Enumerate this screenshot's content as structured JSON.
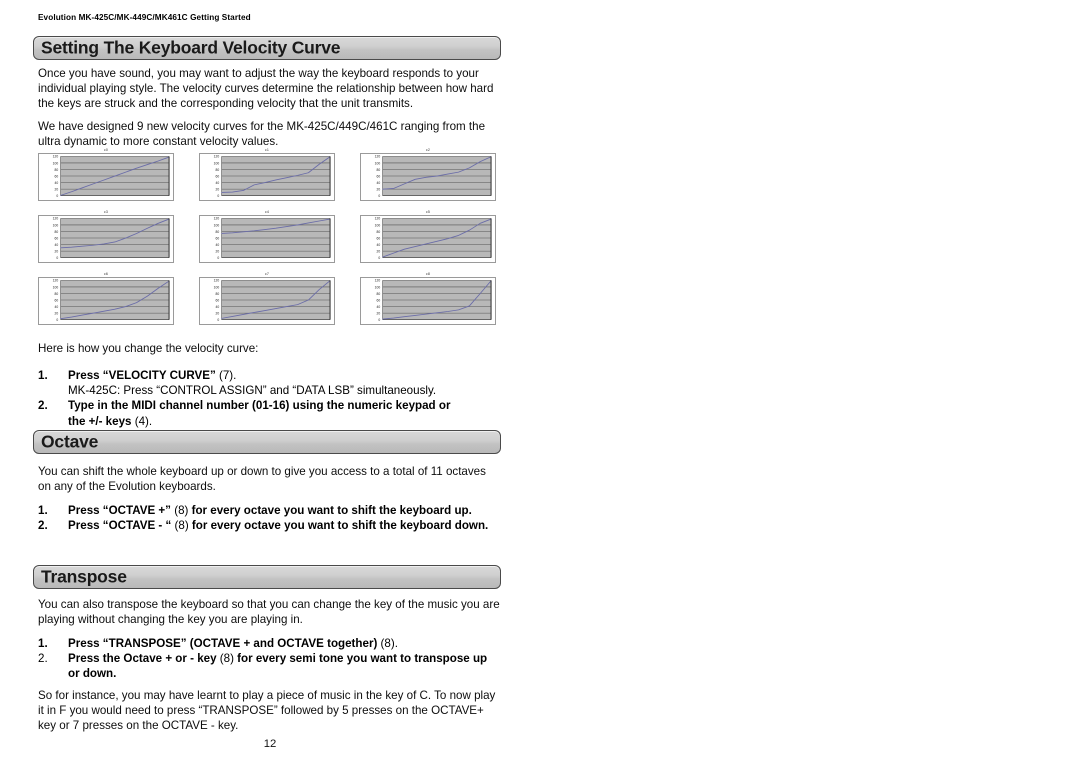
{
  "document": {
    "running_head": "Evolution MK-425C/MK-449C/MK461C Getting Started",
    "page_number": "12"
  },
  "sections": [
    {
      "id": "velocity-curve",
      "heading": "Setting The Keyboard Velocity Curve",
      "paragraphs": [
        [
          "Once you have sound, you may want to adjust the way the keyboard responds to your",
          "individual playing style. The velocity curves determine the relationship between how hard",
          "the keys are struck and the corresponding velocity that the unit transmits."
        ],
        [
          "We have designed 9 new velocity curves for the MK-425C/449C/461C ranging from the",
          "ultra dynamic to more constant velocity values."
        ]
      ],
      "lead_in": "Here is how you change the velocity curve:",
      "steps": [
        {
          "num": "1.",
          "bold": "Press “VELOCITY CURVE”",
          "regular": " (7).",
          "sub": "MK-425C: Press “CONTROL ASSIGN” and “DATA LSB” simultaneously."
        },
        {
          "num": "2.",
          "bold": "Type in the MIDI channel number (01-16) using the numeric keypad or",
          "regular": "",
          "line2_bold": "the +/- keys",
          "line2_regular": " (4)."
        }
      ]
    },
    {
      "id": "octave",
      "heading": "Octave",
      "paragraphs": [
        [
          "You can shift the whole keyboard up or down to give you access to a total of 11 octaves",
          "on any of the Evolution keyboards."
        ]
      ],
      "steps": [
        {
          "num": "1.",
          "bold": "Press “OCTAVE +”",
          "regular": " (8)",
          "bold2": " for every octave you want to shift the keyboard  up."
        },
        {
          "num": "2.",
          "bold": "Press “OCTAVE - “",
          "regular": " (8)",
          "bold2": " for every octave you want to shift the keyboard down."
        }
      ]
    },
    {
      "id": "transpose",
      "heading": "Transpose",
      "paragraphs": [
        [
          "You can also transpose the keyboard so that you can change the key of the music you are",
          "playing without changing the key you are playing in."
        ]
      ],
      "steps": [
        {
          "num": "1.",
          "bold": "Press “TRANSPOSE” (OCTAVE + and OCTAVE together)",
          "regular": " (8)."
        },
        {
          "num": "2.",
          "bold": "Press the Octave + or - key",
          "regular": " (8)",
          "bold2": " for every semi tone you want to transpose up",
          "line2_bold": "or down."
        }
      ],
      "closing": [
        "So for instance, you may have learnt to play a piece of music in the key of C. To now play",
        "it in F you would need to press “TRANSPOSE” followed by 5 presses on the OCTAVE+",
        "key or 7 presses on the OCTAVE - key."
      ]
    }
  ],
  "chart_data": [
    {
      "type": "line",
      "title": "c0",
      "xlabel": "",
      "ylabel": "",
      "ylim": [
        0,
        120
      ],
      "yticks": [
        0,
        20,
        40,
        60,
        80,
        100,
        120
      ],
      "ytick_labels": [
        "0",
        "20",
        "40",
        "60",
        "80",
        "100",
        "120"
      ],
      "grid": true,
      "plot_bg": "#b8b8b8",
      "line_color": "#6a6ca8",
      "x": [
        0,
        10,
        20,
        30,
        40,
        50,
        60,
        70,
        80,
        90,
        100
      ],
      "values": [
        1,
        12,
        24,
        36,
        48,
        60,
        72,
        84,
        95,
        106,
        118
      ]
    },
    {
      "type": "line",
      "title": "c1",
      "xlabel": "",
      "ylabel": "",
      "ylim": [
        0,
        120
      ],
      "yticks": [
        0,
        20,
        40,
        60,
        80,
        100,
        120
      ],
      "ytick_labels": [
        "0",
        "20",
        "40",
        "60",
        "80",
        "100",
        "120"
      ],
      "grid": true,
      "plot_bg": "#b8b8b8",
      "line_color": "#6a6ca8",
      "x": [
        0,
        10,
        20,
        30,
        40,
        50,
        60,
        70,
        80,
        90,
        100
      ],
      "values": [
        10,
        11,
        16,
        33,
        40,
        48,
        55,
        62,
        70,
        96,
        119
      ]
    },
    {
      "type": "line",
      "title": "c2",
      "xlabel": "",
      "ylabel": "",
      "ylim": [
        0,
        120
      ],
      "yticks": [
        0,
        20,
        40,
        60,
        80,
        100,
        120
      ],
      "ytick_labels": [
        "0",
        "20",
        "40",
        "60",
        "80",
        "100",
        "120"
      ],
      "grid": true,
      "plot_bg": "#b8b8b8",
      "line_color": "#6a6ca8",
      "x": [
        0,
        10,
        20,
        30,
        40,
        50,
        60,
        70,
        80,
        90,
        100
      ],
      "values": [
        20,
        22,
        36,
        50,
        56,
        60,
        66,
        72,
        85,
        104,
        119
      ]
    },
    {
      "type": "line",
      "title": "c3",
      "xlabel": "",
      "ylabel": "",
      "ylim": [
        0,
        120
      ],
      "yticks": [
        0,
        20,
        40,
        60,
        80,
        100,
        120
      ],
      "ytick_labels": [
        "0",
        "20",
        "40",
        "60",
        "80",
        "100",
        "120"
      ],
      "grid": true,
      "plot_bg": "#b8b8b8",
      "line_color": "#6a6ca8",
      "x": [
        0,
        10,
        20,
        30,
        40,
        50,
        60,
        70,
        80,
        90,
        100
      ],
      "values": [
        30,
        32,
        35,
        38,
        42,
        48,
        60,
        74,
        90,
        105,
        118
      ]
    },
    {
      "type": "line",
      "title": "c4",
      "xlabel": "",
      "ylabel": "",
      "ylim": [
        0,
        120
      ],
      "yticks": [
        0,
        20,
        40,
        60,
        80,
        100,
        120
      ],
      "ytick_labels": [
        "0",
        "20",
        "40",
        "60",
        "80",
        "100",
        "120"
      ],
      "grid": true,
      "plot_bg": "#b8b8b8",
      "line_color": "#6a6ca8",
      "x": [
        0,
        10,
        20,
        30,
        40,
        50,
        60,
        70,
        80,
        90,
        100
      ],
      "values": [
        74,
        76,
        79,
        82,
        86,
        90,
        95,
        100,
        106,
        112,
        118
      ]
    },
    {
      "type": "line",
      "title": "c5",
      "xlabel": "",
      "ylabel": "",
      "ylim": [
        0,
        120
      ],
      "yticks": [
        0,
        20,
        40,
        60,
        80,
        100,
        120
      ],
      "ytick_labels": [
        "0",
        "20",
        "40",
        "60",
        "80",
        "100",
        "120"
      ],
      "grid": true,
      "plot_bg": "#b8b8b8",
      "line_color": "#6a6ca8",
      "x": [
        0,
        10,
        20,
        30,
        40,
        50,
        60,
        70,
        80,
        90,
        100
      ],
      "values": [
        2,
        14,
        26,
        34,
        42,
        50,
        58,
        68,
        84,
        105,
        118
      ]
    },
    {
      "type": "line",
      "title": "c6",
      "xlabel": "",
      "ylabel": "",
      "ylim": [
        0,
        120
      ],
      "yticks": [
        0,
        20,
        40,
        60,
        80,
        100,
        120
      ],
      "ytick_labels": [
        "0",
        "20",
        "40",
        "60",
        "80",
        "100",
        "120"
      ],
      "grid": true,
      "plot_bg": "#b8b8b8",
      "line_color": "#6a6ca8",
      "x": [
        0,
        10,
        20,
        30,
        40,
        50,
        60,
        70,
        80,
        90,
        100
      ],
      "values": [
        3,
        8,
        14,
        20,
        26,
        32,
        40,
        52,
        72,
        96,
        118
      ]
    },
    {
      "type": "line",
      "title": "c7",
      "xlabel": "",
      "ylabel": "",
      "ylim": [
        0,
        120
      ],
      "yticks": [
        0,
        20,
        40,
        60,
        80,
        100,
        120
      ],
      "ytick_labels": [
        "0",
        "20",
        "40",
        "60",
        "80",
        "100",
        "120"
      ],
      "grid": true,
      "plot_bg": "#b8b8b8",
      "line_color": "#6a6ca8",
      "x": [
        0,
        10,
        20,
        30,
        40,
        50,
        60,
        70,
        80,
        90,
        100
      ],
      "values": [
        4,
        10,
        16,
        22,
        28,
        34,
        40,
        46,
        60,
        92,
        119
      ]
    },
    {
      "type": "line",
      "title": "c8",
      "xlabel": "",
      "ylabel": "",
      "ylim": [
        0,
        120
      ],
      "yticks": [
        0,
        20,
        40,
        60,
        80,
        100,
        120
      ],
      "ytick_labels": [
        "0",
        "20",
        "40",
        "60",
        "80",
        "100",
        "120"
      ],
      "grid": true,
      "plot_bg": "#b8b8b8",
      "line_color": "#6a6ca8",
      "x": [
        0,
        10,
        20,
        30,
        40,
        50,
        60,
        70,
        80,
        90,
        100
      ],
      "values": [
        2,
        5,
        9,
        13,
        17,
        21,
        25,
        30,
        42,
        80,
        119
      ]
    }
  ]
}
